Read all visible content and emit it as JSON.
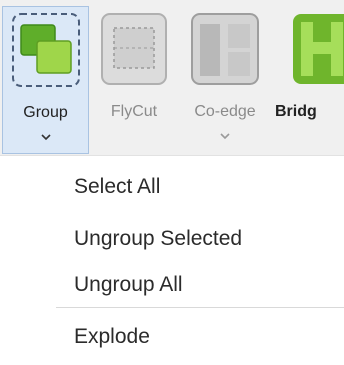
{
  "ribbon": {
    "buttons": [
      {
        "label": "Group",
        "icon": "group-icon",
        "state": "pressed"
      },
      {
        "label": "FlyCut",
        "icon": "flycut-icon",
        "state": "disabled"
      },
      {
        "label": "Co-edge",
        "icon": "coedge-icon",
        "state": "disabled"
      },
      {
        "label": "Bridg",
        "icon": "bridge-icon",
        "state": "normal"
      }
    ]
  },
  "menu": {
    "items": [
      {
        "label": "Select All"
      },
      {
        "label": "Ungroup Selected"
      },
      {
        "label": "Ungroup All"
      },
      {
        "label": "Explode"
      }
    ]
  },
  "colors": {
    "accent_green": "#7bbf2a",
    "pressed_bg": "#dbe8f7",
    "disabled_gray": "#8a8a8a"
  }
}
